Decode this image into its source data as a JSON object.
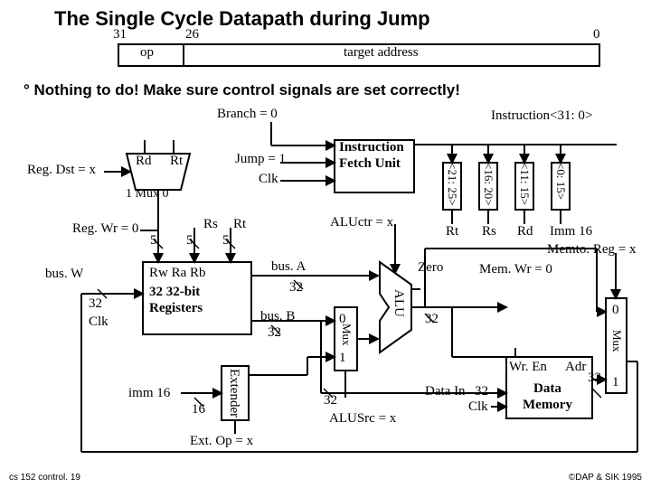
{
  "title": "The Single Cycle Datapath during Jump",
  "instruction_format": {
    "msb": "31",
    "op_end": "26",
    "lsb": "0",
    "field_op": "op",
    "field_target": "target address"
  },
  "note": "°  Nothing to do!  Make sure control signals are set correctly!",
  "signals": {
    "branch": "Branch = 0",
    "jump": "Jump = 1",
    "clk_ifu": "Clk",
    "instruction": "Instruction<31: 0>",
    "regdst": "Reg. Dst = x",
    "rd": "Rd",
    "rt": "Rt",
    "mux1": "1  Mux  0",
    "regwr": "Reg. Wr = 0",
    "busW": "bus. W",
    "n32_1": "32",
    "clk_rf": "Clk",
    "regfile1": "Rw   Ra   Rb",
    "regfile2": "32 32-bit",
    "regfile3": "Registers",
    "rs": "Rs",
    "rt2": "Rt",
    "five1": "5",
    "five2": "5",
    "five3": "5",
    "busA": "bus. A",
    "n32_a": "32",
    "busB": "bus. B",
    "n32_b": "32",
    "imm16": "imm 16",
    "n16": "16",
    "extender": "Extender",
    "n32_e": "32",
    "alusrc": "ALUSrc = x",
    "mux2_0": "0",
    "mux2_1": "1",
    "mux2": "Mux",
    "aluctr": "ALUctr = x",
    "alu": "ALU",
    "zero": "Zero",
    "n32_alu": "32",
    "ifu": "Instruction\nFetch Unit",
    "bits21": "<21: 25>",
    "bits16": "<16: 20>",
    "bits11": "<11: 15>",
    "bits0": "<0: 15>",
    "rt3": "Rt",
    "rs2": "Rs",
    "rd2": "Rd",
    "imm16_2": "Imm 16",
    "memtoreg": "Memto. Reg = x",
    "memwr": "Mem. Wr = 0",
    "wren": "Wr. En",
    "adr": "Adr",
    "datain": "Data In",
    "n32_di": "32",
    "dmem1": "Data",
    "dmem2": "Memory",
    "clk_dm": "Clk",
    "mux3_0": "0",
    "mux3_1": "1",
    "mux3": "Mux",
    "n32_m": "32",
    "extop": "Ext. Op = x"
  },
  "footer": {
    "left": "cs 152  control. 19",
    "right": "©DAP & SIK 1995"
  }
}
